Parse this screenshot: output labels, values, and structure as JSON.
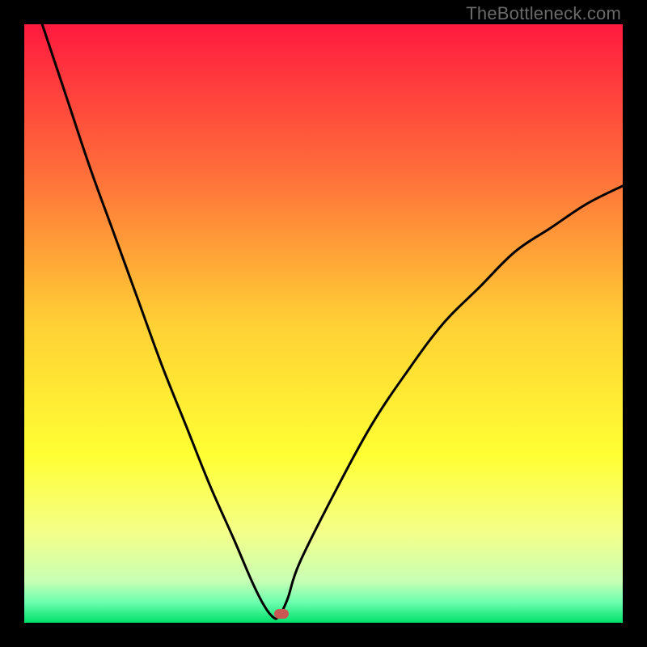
{
  "watermark": "TheBottleneck.com",
  "chart_data": {
    "type": "line",
    "title": "",
    "xlabel": "",
    "ylabel": "",
    "x_range": [
      0,
      100
    ],
    "y_range": [
      0,
      100
    ],
    "background_gradient": [
      {
        "stop": 0.0,
        "color": "#ff1a3f"
      },
      {
        "stop": 0.25,
        "color": "#ff6f3a"
      },
      {
        "stop": 0.5,
        "color": "#ffd035"
      },
      {
        "stop": 0.72,
        "color": "#ffff33"
      },
      {
        "stop": 0.85,
        "color": "#f4ff8a"
      },
      {
        "stop": 0.93,
        "color": "#c8ffb4"
      },
      {
        "stop": 0.965,
        "color": "#6fffb0"
      },
      {
        "stop": 1.0,
        "color": "#00e06a"
      }
    ],
    "series": [
      {
        "name": "bottleneck-curve",
        "x": [
          3,
          7,
          11,
          15,
          19,
          23,
          27,
          31,
          35,
          38,
          40,
          41.5,
          42.5,
          44,
          46,
          52,
          58,
          64,
          70,
          76,
          82,
          88,
          94,
          100
        ],
        "y": [
          100,
          88,
          76,
          65,
          54,
          43,
          33,
          23,
          14,
          7,
          3,
          1,
          1,
          4,
          10,
          22,
          33,
          42,
          50,
          56,
          62,
          66,
          70,
          73
        ]
      }
    ],
    "marker": {
      "x": 43,
      "y": 1.5,
      "color": "#C95852"
    },
    "description": "V-shaped bottleneck curve on vertical red-to-green gradient; minimum near x≈43 where curve touches green band; red marker pill sits at the minimum."
  }
}
